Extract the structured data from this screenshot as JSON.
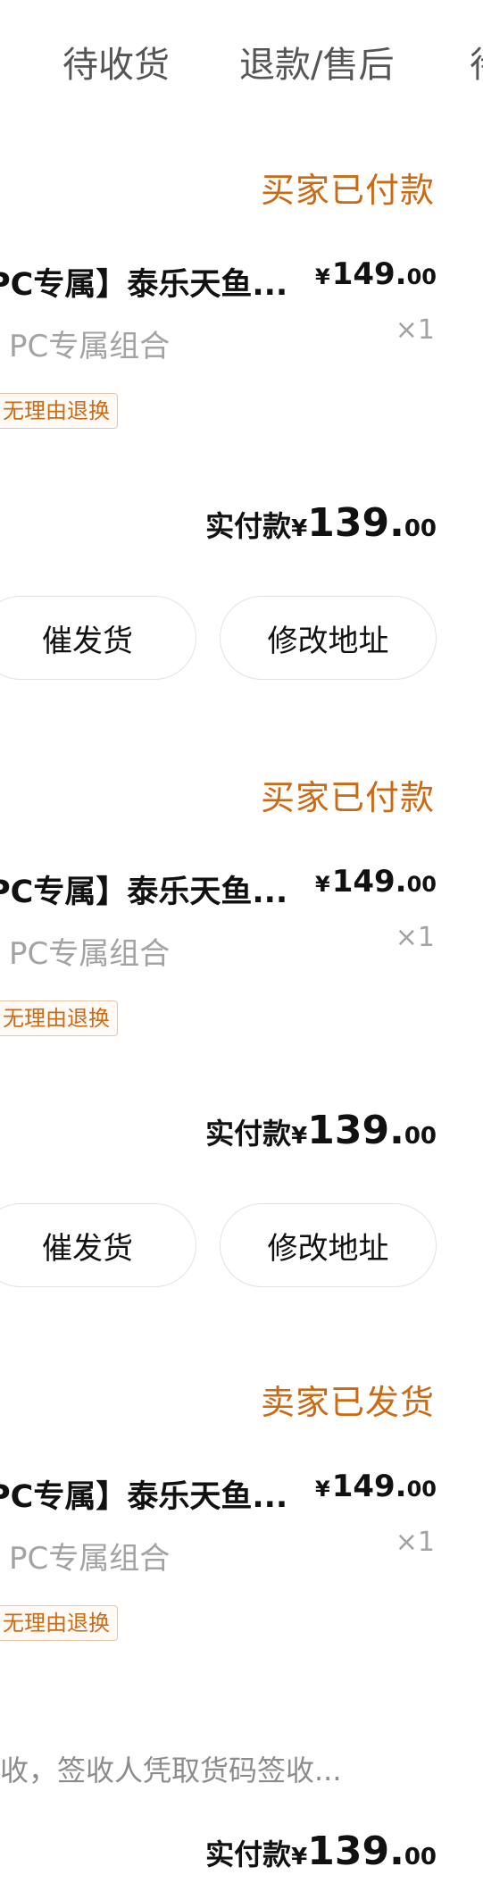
{
  "tabs": [
    {
      "label": "待收货"
    },
    {
      "label": "退款/售后"
    },
    {
      "label": "待"
    }
  ],
  "orders": [
    {
      "status": "买家已付款",
      "product_title": "PC专属】泰乐天鱼...",
      "price_symbol": "¥",
      "price_int": "149.",
      "price_dec": "00",
      "sku": "PC专属组合",
      "quantity": "×1",
      "tag": "无理由退换",
      "paid_label": "实付款",
      "paid_symbol": "¥",
      "paid_int": "139.",
      "paid_dec": "00",
      "buttons": {
        "urge": "催发货",
        "change_address": "修改地址"
      }
    },
    {
      "status": "买家已付款",
      "product_title": "PC专属】泰乐天鱼...",
      "price_symbol": "¥",
      "price_int": "149.",
      "price_dec": "00",
      "sku": "PC专属组合",
      "quantity": "×1",
      "tag": "无理由退换",
      "paid_label": "实付款",
      "paid_symbol": "¥",
      "paid_int": "139.",
      "paid_dec": "00",
      "buttons": {
        "urge": "催发货",
        "change_address": "修改地址"
      }
    },
    {
      "status": "卖家已发货",
      "product_title": "PC专属】泰乐天鱼...",
      "price_symbol": "¥",
      "price_int": "149.",
      "price_dec": "00",
      "sku": "PC专属组合",
      "quantity": "×1",
      "tag": "无理由退换",
      "pickup_note": "收，签收人凭取货码签收...",
      "paid_label": "实付款",
      "paid_symbol": "¥",
      "paid_int": "139.",
      "paid_dec": "00"
    }
  ]
}
